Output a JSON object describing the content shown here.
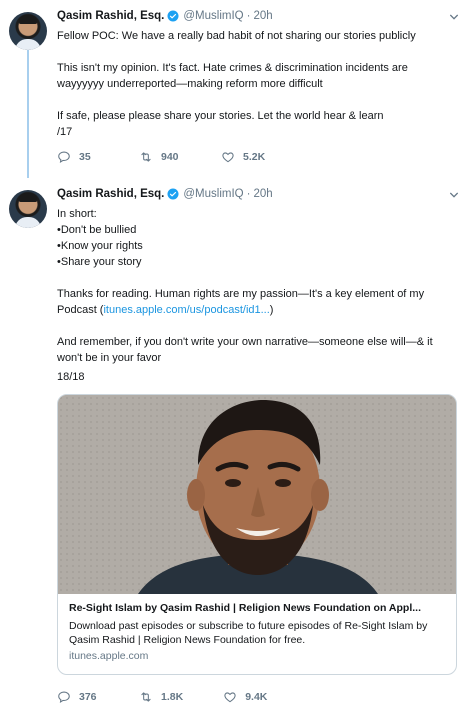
{
  "tweets": [
    {
      "author_name": "Qasim Rashid, Esq.",
      "handle": "@MuslimIQ",
      "separator": "·",
      "time": "20h",
      "lines": [
        "Fellow POC: We have a really bad habit of not sharing our stories publicly",
        "",
        "This isn't my opinion. It's fact. Hate crimes & discrimination incidents are",
        "wayyyyyy underreported—making reform more difficult",
        "",
        "If safe, please please share your stories. Let the world hear & learn",
        "/17"
      ],
      "replies": "35",
      "retweets": "940",
      "likes": "5.2K"
    },
    {
      "author_name": "Qasim Rashid, Esq.",
      "handle": "@MuslimIQ",
      "separator": "·",
      "time": "20h",
      "lines": [
        "In short:",
        "•Don't be bullied",
        "•Know your rights",
        "•Share your story",
        "",
        "Thanks for reading. Human rights are my passion—It's a key element of my",
        "Podcast ("
      ],
      "link_text": "itunes.apple.com/us/podcast/id1...",
      "link_after": ")",
      "closing_lines": [
        "And remember, if you don't write your own narrative—someone else will—& it",
        "won't be in your favor"
      ],
      "page_count": "18/18",
      "card": {
        "title": "Re-Sight Islam by Qasim Rashid | Religion News Foundation on Appl...",
        "description": "Download past episodes or subscribe to future episodes of Re-Sight Islam by Qasim Rashid | Religion News Foundation for free.",
        "domain": "itunes.apple.com"
      },
      "replies": "376",
      "retweets": "1.8K",
      "likes": "9.4K"
    }
  ],
  "colors": {
    "accent": "#1b95e0",
    "muted": "#657786",
    "thread_line": "#a8cfee",
    "verified": "#1da1f2"
  },
  "icons": [
    "verified-badge-icon",
    "chevron-down-icon",
    "reply-icon",
    "retweet-icon",
    "like-icon"
  ]
}
